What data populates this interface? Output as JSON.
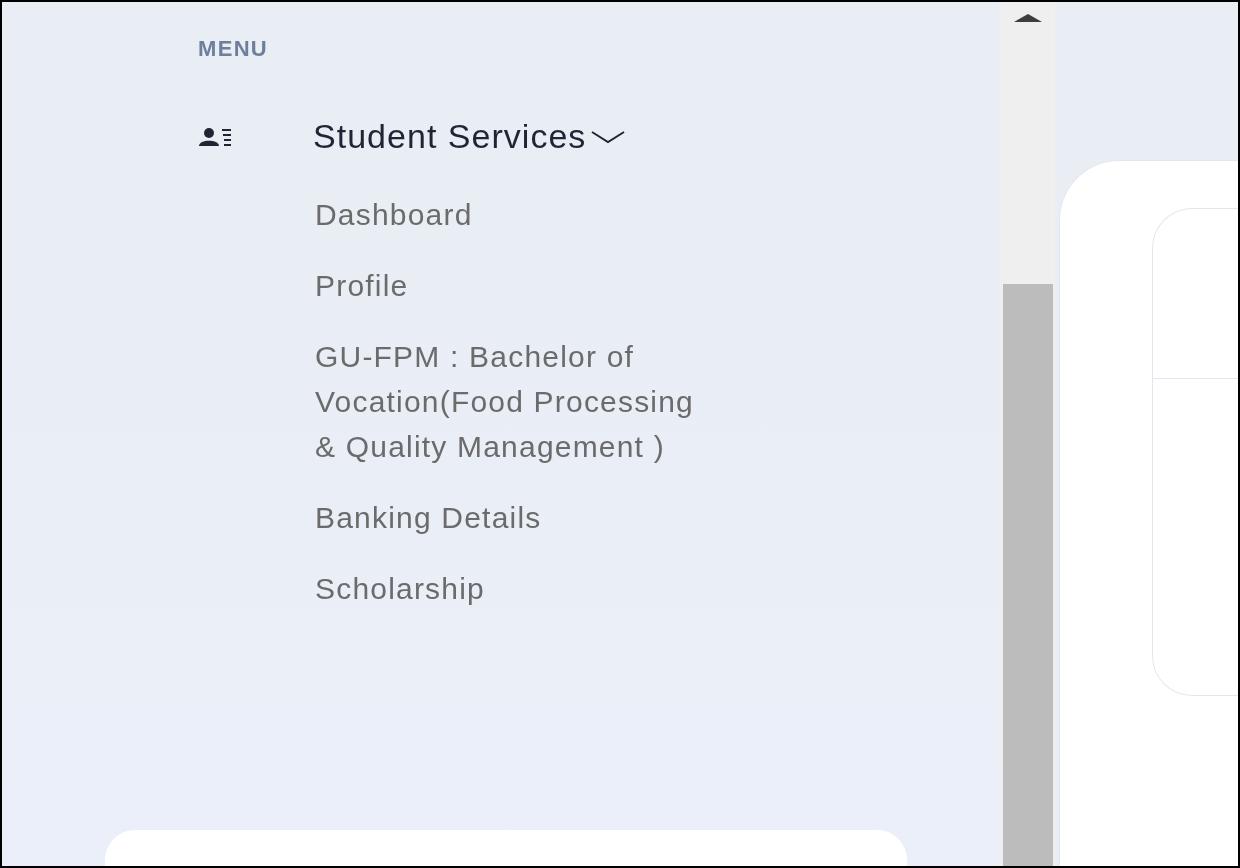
{
  "sidebar": {
    "heading": "MENU",
    "group": {
      "label": "Student Services",
      "expanded": true,
      "items": [
        {
          "label": "Dashboard"
        },
        {
          "label": "Profile"
        },
        {
          "label": "GU-FPM : Bachelor of Vocation(Food Processing & Quality Management )"
        },
        {
          "label": "Banking Details"
        },
        {
          "label": "Scholarship"
        }
      ]
    }
  }
}
